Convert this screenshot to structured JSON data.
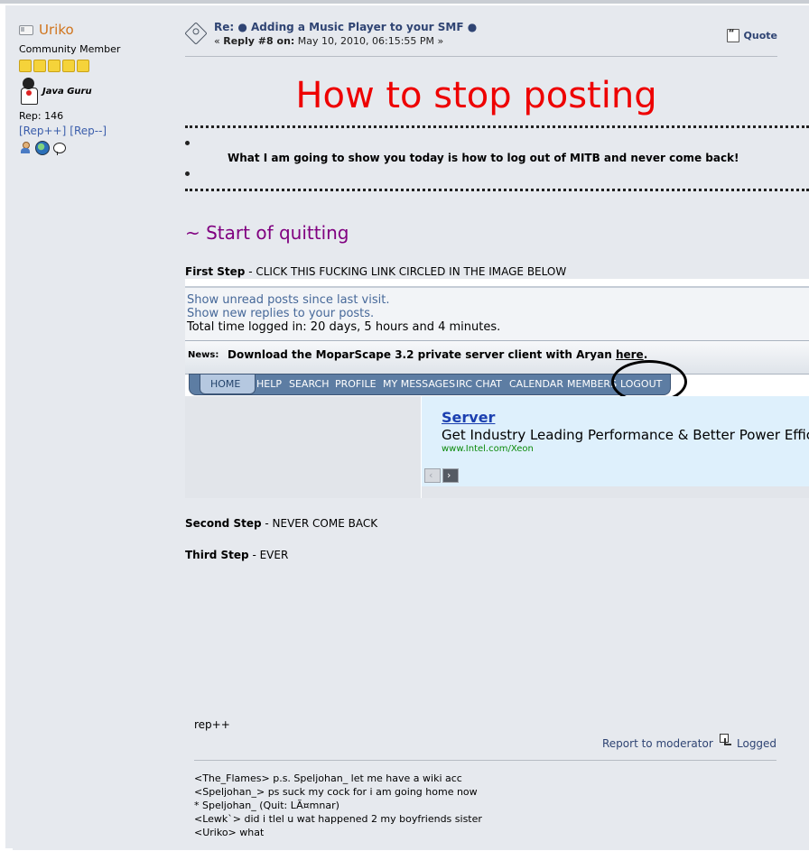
{
  "poster": {
    "name": "Uriko",
    "rank": "Community Member",
    "badge_text": "Java Guru",
    "rep": "Rep: 146",
    "rep_plus": "[Rep++]",
    "rep_minus": "[Rep--]"
  },
  "header": {
    "subject": "Re: ● Adding a Music Player to your SMF ●",
    "reply_prefix": "« ",
    "reply_label": "Reply #8 on:",
    "reply_date": " May 10, 2010, 06:15:55 PM »",
    "quote_label": "Quote"
  },
  "body": {
    "title": "How to stop posting",
    "intro": "What I am going to show you today is how to log out of MITB and never come back!",
    "section_title": "~ Start of quitting",
    "step1_label": "First Step",
    "step1_text": " - CLICK THIS FUCKING LINK CIRCLED IN THE IMAGE BELOW",
    "step2_label": "Second Step",
    "step2_text": " - NEVER COME BACK",
    "step3_label": "Third Step",
    "step3_text": " - EVER"
  },
  "embed": {
    "unread": "Show unread posts since last visit.",
    "new_replies": "Show new replies to your posts.",
    "time_logged": "Total time logged in: 20 days, 5 hours and 4 minutes.",
    "news_label": "News:",
    "news_text": "Download the MoparScape 3.2 private server client with Aryan ",
    "news_link": "here",
    "news_end": ".",
    "menu": [
      "HOME",
      "HELP",
      "SEARCH",
      "PROFILE",
      "MY MESSAGES",
      "IRC CHAT",
      "CALENDAR",
      "MEMBERS",
      "LOGOUT"
    ],
    "ad_title": "Server",
    "ad_text": "Get Industry Leading Performance & Better Power Efficienc",
    "ad_url": "www.Intel.com/Xeon"
  },
  "footer": {
    "rep_text": "rep++",
    "report_label": "Report to moderator",
    "logged_label": "Logged"
  },
  "signature": [
    "<The_Flames> p.s. Speljohan_ let me have a wiki acc",
    "<Speljohan_> ps suck my cock for i am going home now",
    "* Speljohan_ (Quit: LÃ¤mnar)",
    "<Lewk`> did i tlel u wat happened 2 my boyfriends sister",
    "<Uriko> what"
  ]
}
